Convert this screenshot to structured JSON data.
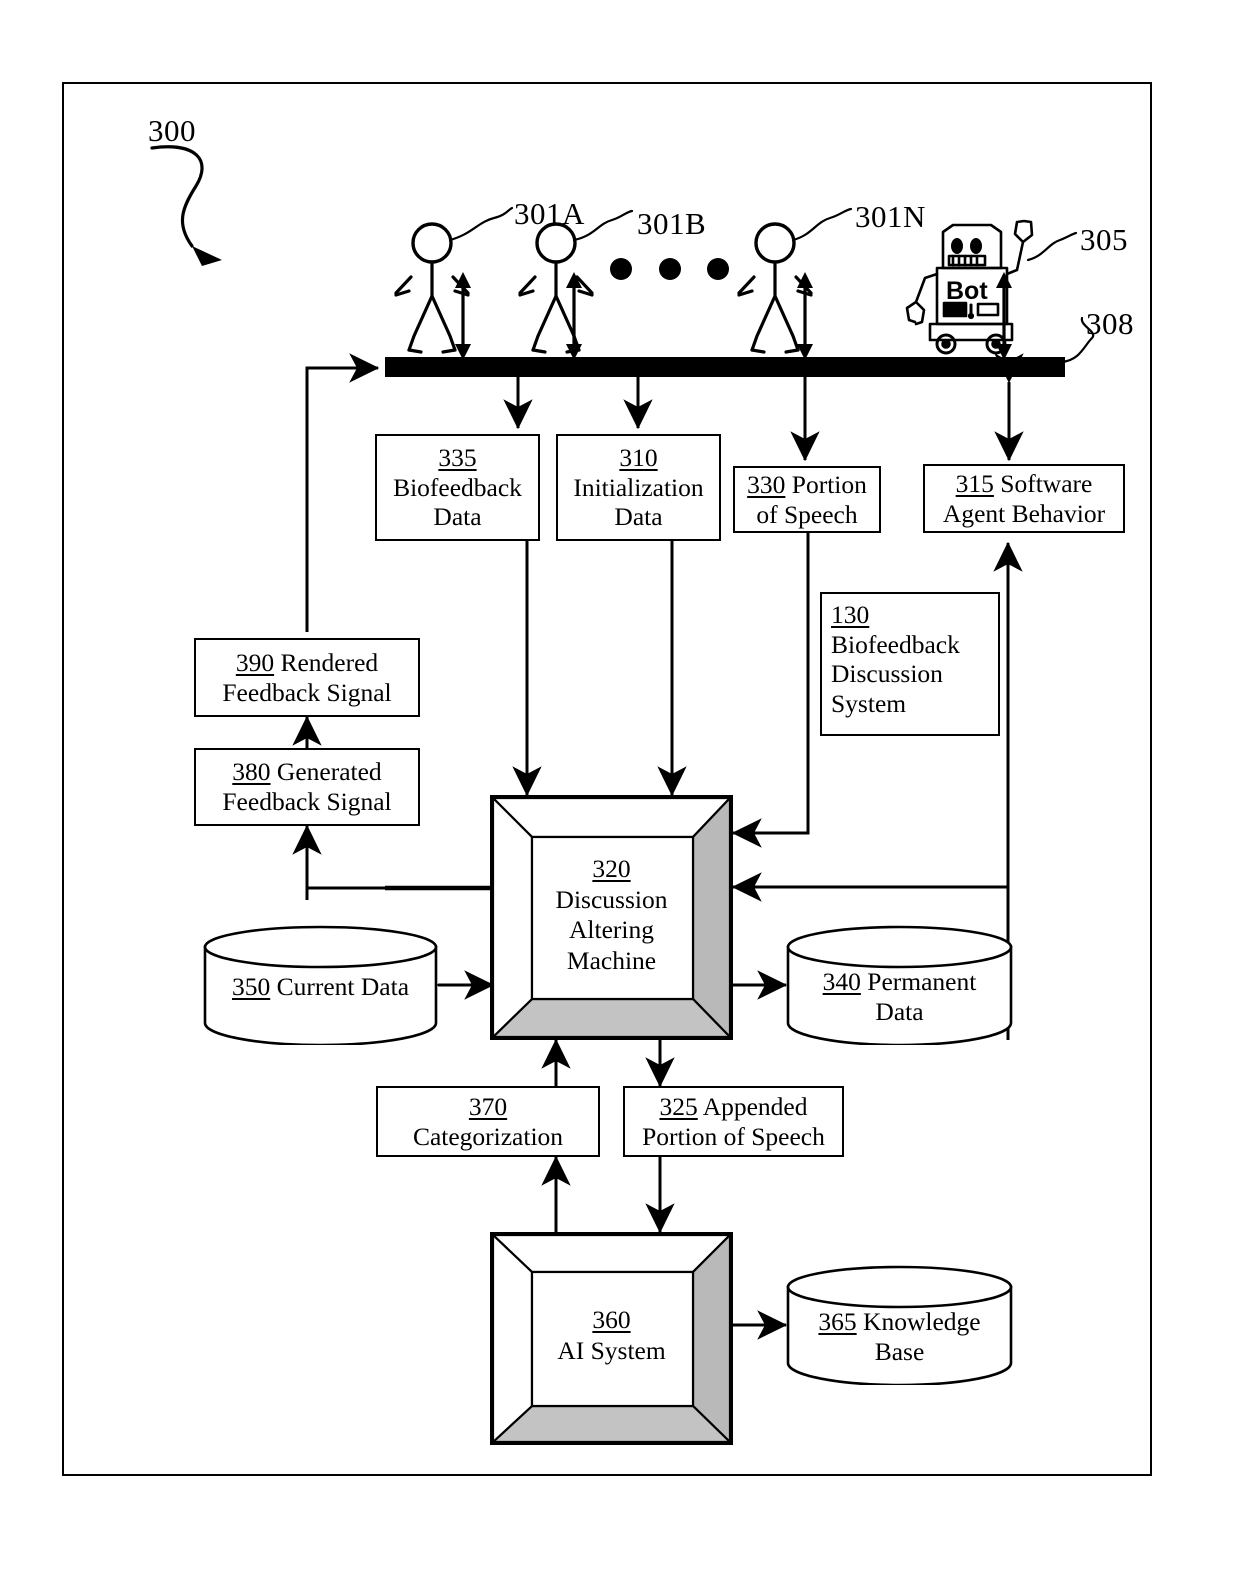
{
  "figure": {
    "ref": "300",
    "bus_ref": "308",
    "bot_ref": "305",
    "bot_label": "Bot",
    "participants": [
      {
        "ref": "301A"
      },
      {
        "ref": "301B"
      },
      {
        "ref": "301N"
      }
    ]
  },
  "boxes": {
    "b335": {
      "num": "335",
      "lines": [
        "Biofeedback",
        "Data"
      ],
      "inline": false
    },
    "b310": {
      "num": "310",
      "lines": [
        "Initialization",
        "Data"
      ],
      "inline": false
    },
    "b330": {
      "num": "330",
      "first": "Portion",
      "lines": [
        "of Speech"
      ],
      "inline": true
    },
    "b315": {
      "num": "315",
      "first": "Software",
      "lines": [
        "Agent Behavior"
      ],
      "inline": true
    },
    "b130": {
      "num": "130",
      "lines": [
        "Biofeedback",
        "Discussion",
        "System"
      ],
      "inline": false
    },
    "b390": {
      "num": "390",
      "first": "Rendered",
      "lines": [
        "Feedback Signal"
      ],
      "inline": true
    },
    "b380": {
      "num": "380",
      "first": "Generated",
      "lines": [
        "Feedback Signal"
      ],
      "inline": true
    },
    "b370": {
      "num": "370",
      "lines": [
        "Categorization"
      ],
      "inline": false
    },
    "b325": {
      "num": "325",
      "first": "Appended",
      "lines": [
        "Portion of Speech"
      ],
      "inline": true
    }
  },
  "machines": {
    "m320": {
      "num": "320",
      "lines": [
        "Discussion",
        "Altering",
        "Machine"
      ]
    },
    "m360": {
      "num": "360",
      "lines": [
        "AI System"
      ]
    }
  },
  "cylinders": {
    "c350": {
      "num": "350",
      "first": "Current Data",
      "lines": []
    },
    "c340": {
      "num": "340",
      "first": "Permanent",
      "lines": [
        "Data"
      ]
    },
    "c365": {
      "num": "365",
      "first": "Knowledge",
      "lines": [
        "Base"
      ]
    }
  },
  "colors": {
    "ink": "#000000",
    "paper": "#ffffff",
    "shade": "#b4b4b4"
  }
}
